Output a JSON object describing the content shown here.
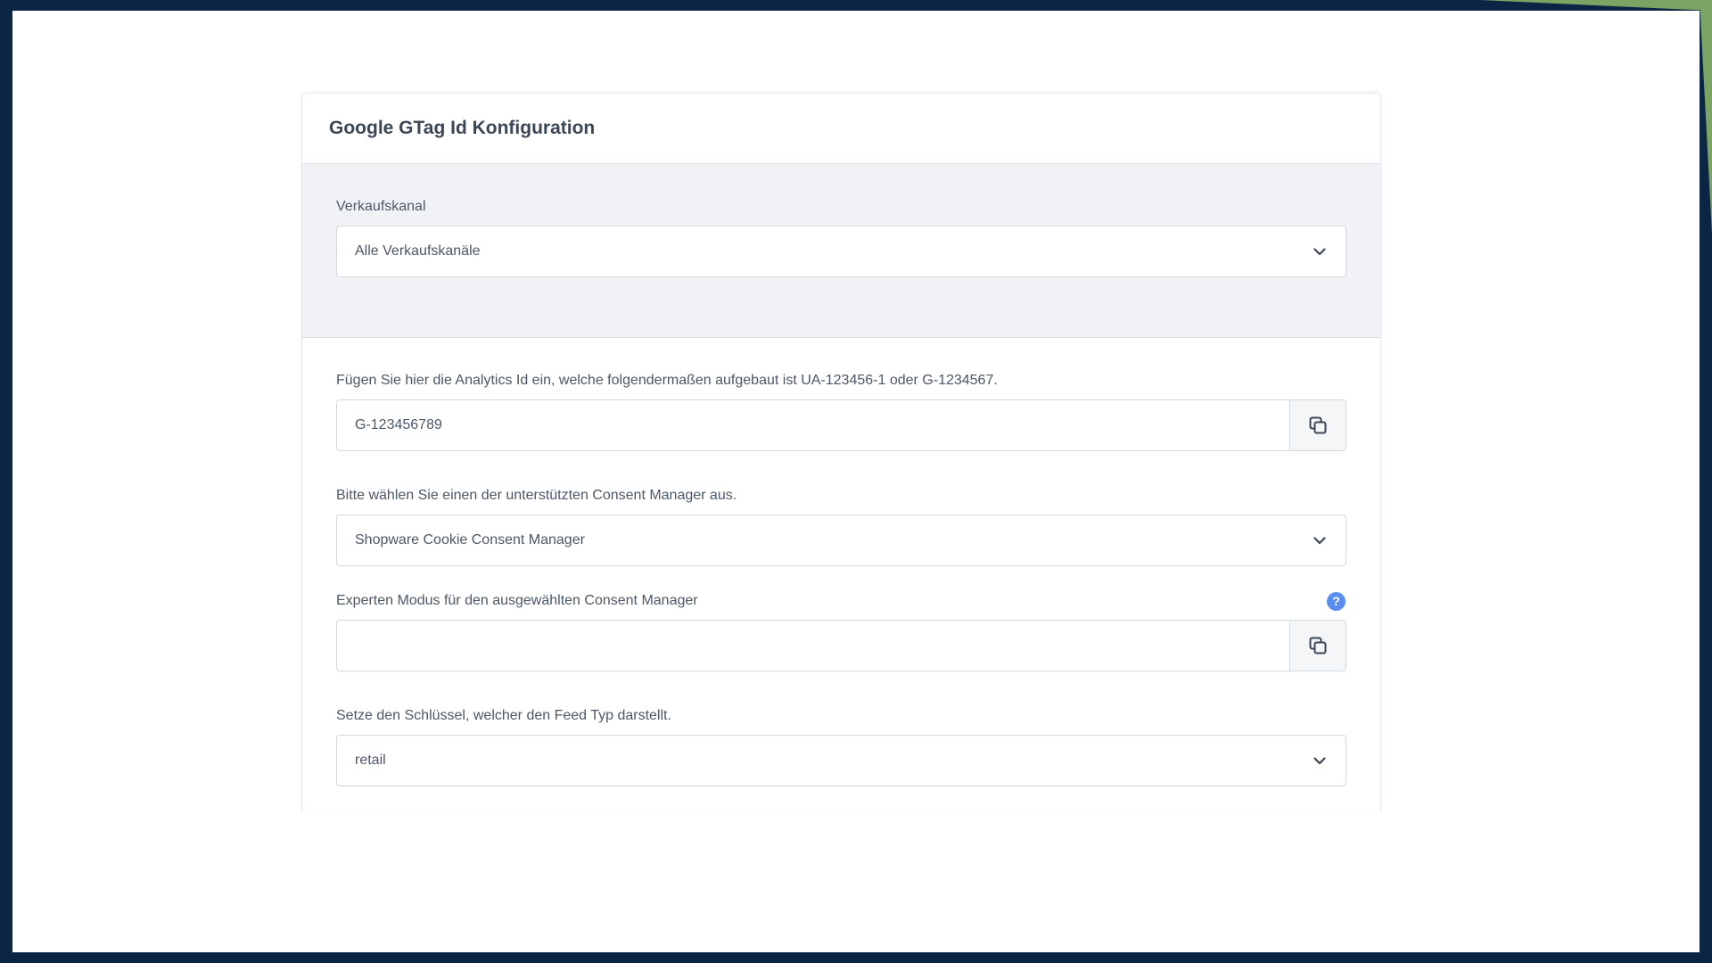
{
  "card": {
    "title": "Google GTag Id Konfiguration"
  },
  "sales_channel": {
    "label": "Verkaufskanal",
    "selected": "Alle Verkaufskanäle"
  },
  "analytics_id": {
    "label": "Fügen Sie hier die Analytics Id ein, welche folgendermaßen aufgebaut ist UA-123456-1 oder G-1234567.",
    "value": "G-123456789"
  },
  "consent_manager": {
    "label": "Bitte wählen Sie einen der unterstützten Consent Manager aus.",
    "selected": "Shopware Cookie Consent Manager"
  },
  "expert_mode": {
    "label": "Experten Modus für den ausgewählten Consent Manager",
    "value": "",
    "help_icon": "?"
  },
  "feed_type": {
    "label": "Setze den Schlüssel, welcher den Feed Typ darstellt.",
    "selected": "retail"
  },
  "colors": {
    "frame": "#0b2544",
    "accent": "#7aa464",
    "help": "#5b8def"
  },
  "icons": {
    "dropdown": "chevron-down-icon",
    "copy": "copy-icon",
    "help": "help-icon"
  }
}
